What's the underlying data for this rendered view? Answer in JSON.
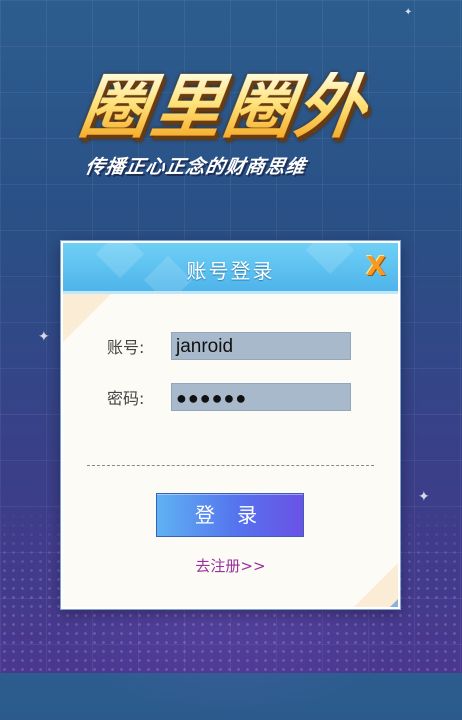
{
  "logo": {
    "title": "圈里圈外",
    "subtitle": "传播正心正念的财商思维"
  },
  "login_dialog": {
    "title": "账号登录",
    "close_glyph": "X",
    "username_label": "账号:",
    "username_value": "janroid",
    "password_label": "密码:",
    "password_value": "●●●●●●",
    "login_button": "登 录",
    "register_link": "去注册>>"
  },
  "colors": {
    "header": "#4eb4ea",
    "button_start": "#5fb2f2",
    "button_end": "#6a52e6",
    "register_link": "#9a2fa0",
    "close_icon": "#f59a23"
  }
}
